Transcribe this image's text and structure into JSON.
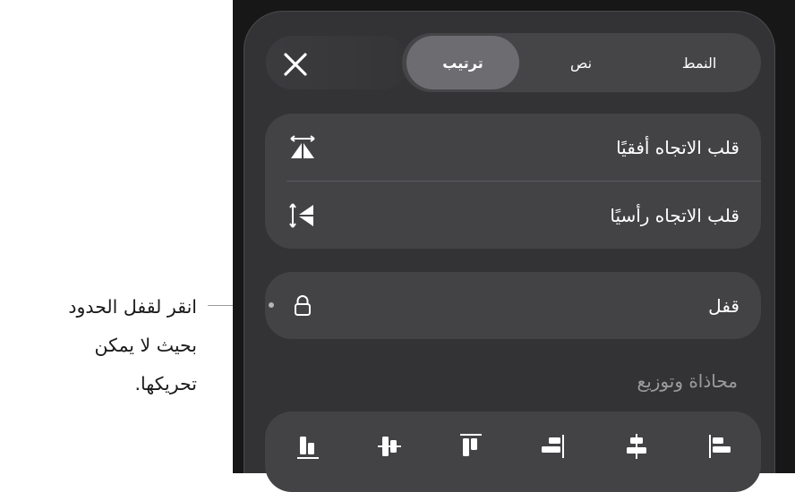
{
  "callout": {
    "lines": [
      "انقر لقفل الحدود",
      "بحيث لا يمكن",
      "تحريكها."
    ]
  },
  "tabs": {
    "style": "النمط",
    "text": "نص",
    "arrange": "ترتيب",
    "selected": "arrange"
  },
  "rows": {
    "flip_horizontal": "قلب الاتجاه أفقيًا",
    "flip_vertical": "قلب الاتجاه رأسيًا",
    "lock": "قفل"
  },
  "section": {
    "align_distribute": "محاذاة وتوزيع"
  },
  "icons": {
    "close": "close-icon",
    "flip_horizontal": "flip-horizontal-icon",
    "flip_vertical": "flip-vertical-icon",
    "lock": "lock-icon",
    "align": [
      "align-bottom-icon",
      "align-middle-icon",
      "align-top-icon",
      "align-right-icon",
      "align-center-icon",
      "align-left-icon"
    ]
  },
  "colors": {
    "panel_bg": "#171717",
    "card_bg": "#333335",
    "group_bg": "#434346",
    "selected_tab": "#6d6d71",
    "text": "#ffffff"
  }
}
